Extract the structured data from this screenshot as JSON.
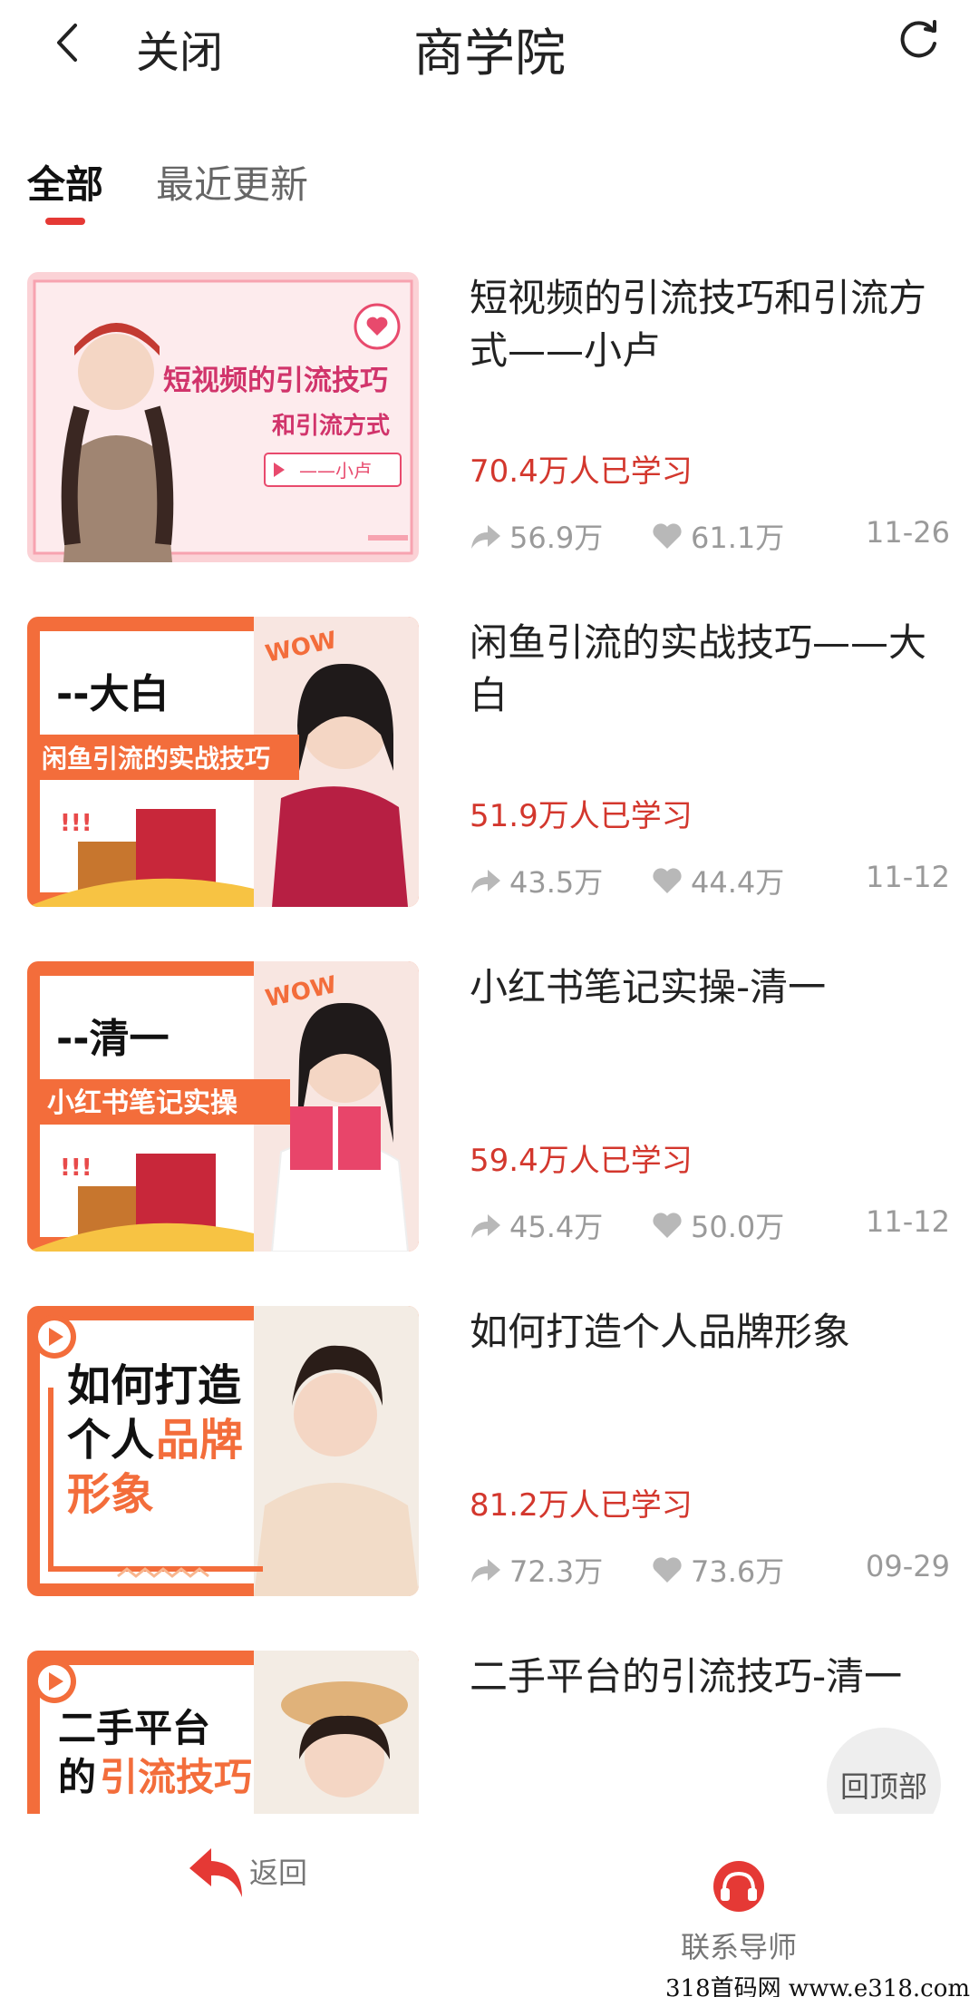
{
  "header": {
    "close_label": "关闭",
    "title": "商学院"
  },
  "tabs": [
    {
      "label": "全部",
      "active": true
    },
    {
      "label": "最近更新",
      "active": false
    }
  ],
  "items": [
    {
      "title": "短视频的引流技巧和引流方式——小卢",
      "learners": "70.4万人已学习",
      "shares": "56.9万",
      "likes": "61.1万",
      "date": "11-26",
      "thumb": {
        "line1": "短视频的引流技巧",
        "line2": "和引流方式",
        "line3": "——小卢"
      }
    },
    {
      "title": "闲鱼引流的实战技巧——大白",
      "learners": "51.9万人已学习",
      "shares": "43.5万",
      "likes": "44.4万",
      "date": "11-12",
      "thumb": {
        "wow": "WOW",
        "name": "--大白",
        "banner": "闲鱼引流的实战技巧",
        "marks": "!!!"
      }
    },
    {
      "title": "小红书笔记实操-清一",
      "learners": "59.4万人已学习",
      "shares": "45.4万",
      "likes": "50.0万",
      "date": "11-12",
      "thumb": {
        "wow": "WOW",
        "name": "--清一",
        "banner": "小红书笔记实操",
        "marks": "!!!"
      }
    },
    {
      "title": "如何打造个人品牌形象",
      "learners": "81.2万人已学习",
      "shares": "72.3万",
      "likes": "73.6万",
      "date": "09-29",
      "thumb": {
        "line1": "如何打造",
        "line2a": "个人",
        "line2b": "品牌",
        "line3": "形象"
      }
    },
    {
      "title": "二手平台的引流技巧-清一",
      "thumb": {
        "line1": "二手平台",
        "line2a": "的",
        "line2b": "引流技巧"
      }
    }
  ],
  "to_top_label": "回顶部",
  "bottom_nav": {
    "back_label": "返回",
    "mentor_label": "联系导师"
  },
  "watermark": "318首码网 www.e318.com",
  "colors": {
    "accent": "#e53935",
    "learners": "#d3372d",
    "thumb_orange": "#f36d3b"
  }
}
